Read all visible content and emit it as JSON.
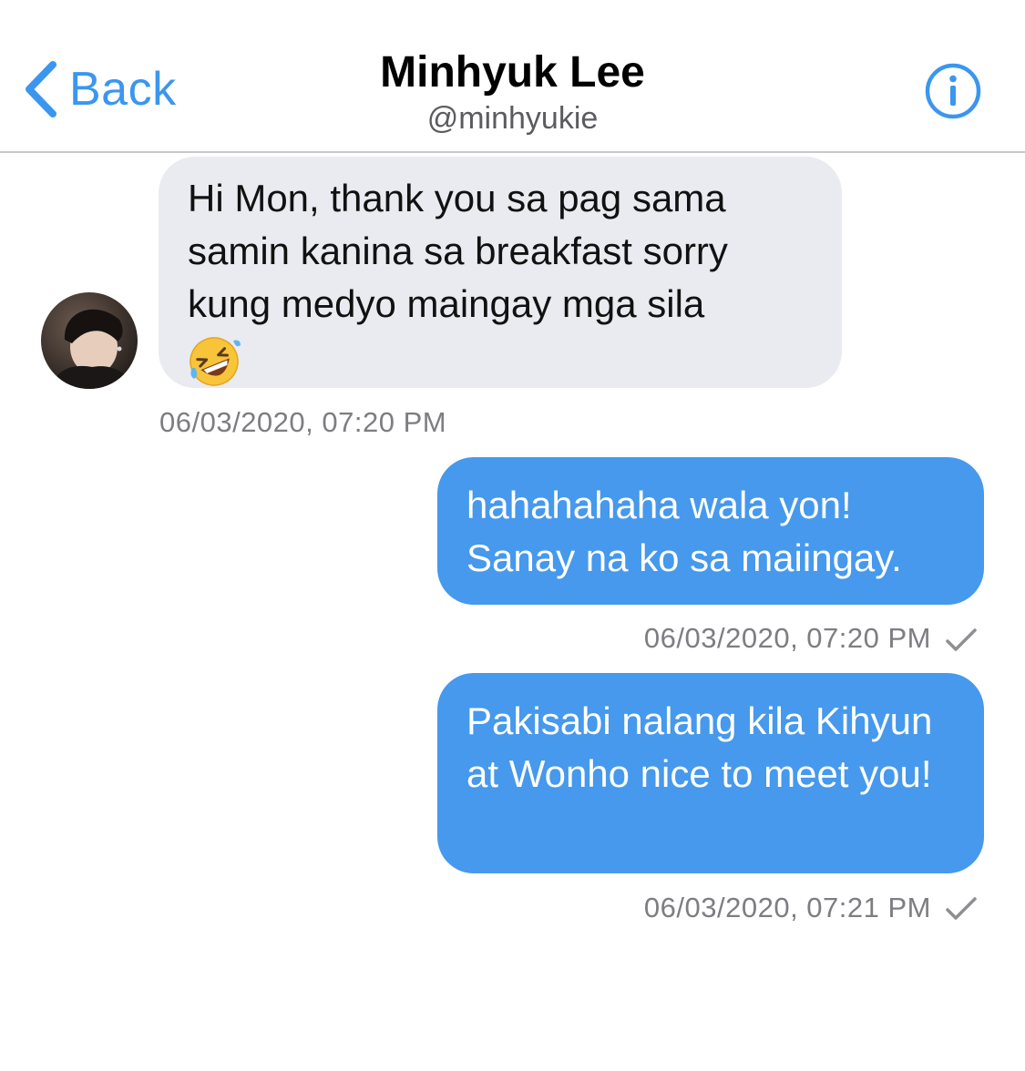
{
  "header": {
    "back_label": "Back",
    "name": "Minhyuk Lee",
    "handle": "@minhyukie"
  },
  "messages": [
    {
      "direction": "incoming",
      "text": "Hi Mon, thank you sa pag sama samin kanina sa breakfast sorry kung medyo maingay mga sila",
      "emoji": "rolling-on-the-floor-laughing",
      "timestamp": "06/03/2020, 07:20 PM"
    },
    {
      "direction": "outgoing",
      "text": "hahahahaha wala yon! Sanay na ko sa maiingay.",
      "timestamp": "06/03/2020, 07:20 PM",
      "status_icon": "check-icon"
    },
    {
      "direction": "outgoing",
      "text": "Pakisabi nalang kila Kihyun at Wonho nice to meet you!",
      "timestamp": "06/03/2020, 07:21 PM",
      "status_icon": "check-icon"
    }
  ],
  "colors": {
    "accent": "#3b96f0",
    "outgoing_bubble": "#4699ec",
    "incoming_bubble": "#e9ebf0",
    "timestamp": "#7d7d82"
  }
}
